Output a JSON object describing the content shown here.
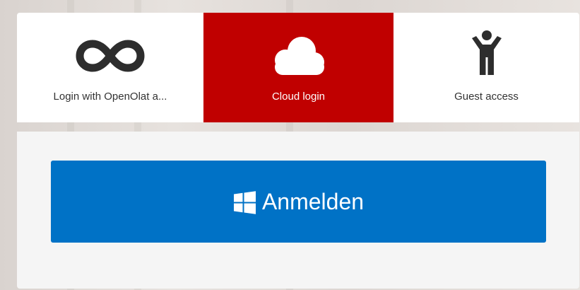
{
  "colors": {
    "active_tab_bg": "#c00000",
    "signin_button_bg": "#0072c6",
    "icon_dark": "#2d2d2d",
    "icon_light": "#ffffff"
  },
  "tabs": [
    {
      "label": "Login with OpenOlat a...",
      "icon": "infinity-icon",
      "active": false
    },
    {
      "label": "Cloud login",
      "icon": "cloud-icon",
      "active": true
    },
    {
      "label": "Guest access",
      "icon": "person-icon",
      "active": false
    }
  ],
  "panel": {
    "signin_button": {
      "label": "Anmelden",
      "icon": "windows-icon"
    }
  }
}
